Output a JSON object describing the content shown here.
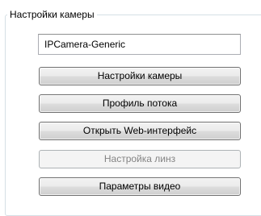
{
  "group": {
    "title": "Настройки камеры"
  },
  "camera_name": {
    "value": "IPCamera-Generic"
  },
  "buttons": [
    {
      "label": "Настройки камеры",
      "enabled": true
    },
    {
      "label": "Профиль потока",
      "enabled": true
    },
    {
      "label": "Открыть Web-интерфейс",
      "enabled": true
    },
    {
      "label": "Настройка линз",
      "enabled": false
    },
    {
      "label": "Параметры видео",
      "enabled": true
    }
  ]
}
